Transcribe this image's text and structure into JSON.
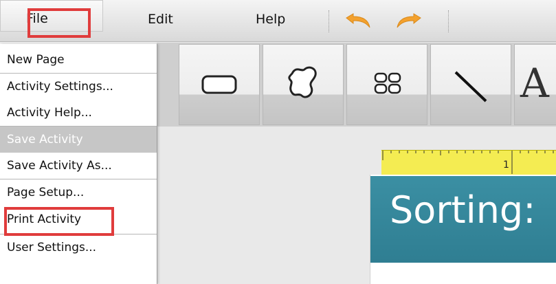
{
  "menubar": {
    "file": "File",
    "edit": "Edit",
    "help": "Help"
  },
  "icons": {
    "undo": "undo-icon",
    "redo": "redo-icon",
    "rectangle_tool": "rounded-rectangle-icon",
    "freeform_tool": "freeform-shape-icon",
    "grid_tool": "grid-icon",
    "line_tool": "line-icon",
    "text_tool": "text-icon"
  },
  "toolbar": {
    "text_tool_glyph": "A"
  },
  "file_menu": {
    "items": [
      {
        "label": "New Page"
      },
      {
        "label": "Activity Settings..."
      },
      {
        "label": "Activity Help..."
      },
      {
        "label": "Save Activity",
        "disabled": true
      },
      {
        "label": "Save Activity As..."
      },
      {
        "label": "Page Setup..."
      },
      {
        "label": "Print Activity"
      },
      {
        "label": "User Settings..."
      }
    ]
  },
  "ruler": {
    "mark": "1"
  },
  "canvas": {
    "banner_title": "Sorting:"
  },
  "colors": {
    "highlight": "#e03c3c",
    "banner": "#3b8fa3",
    "ruler": "#f4ec52",
    "undo_redo": "#f3a12e"
  }
}
